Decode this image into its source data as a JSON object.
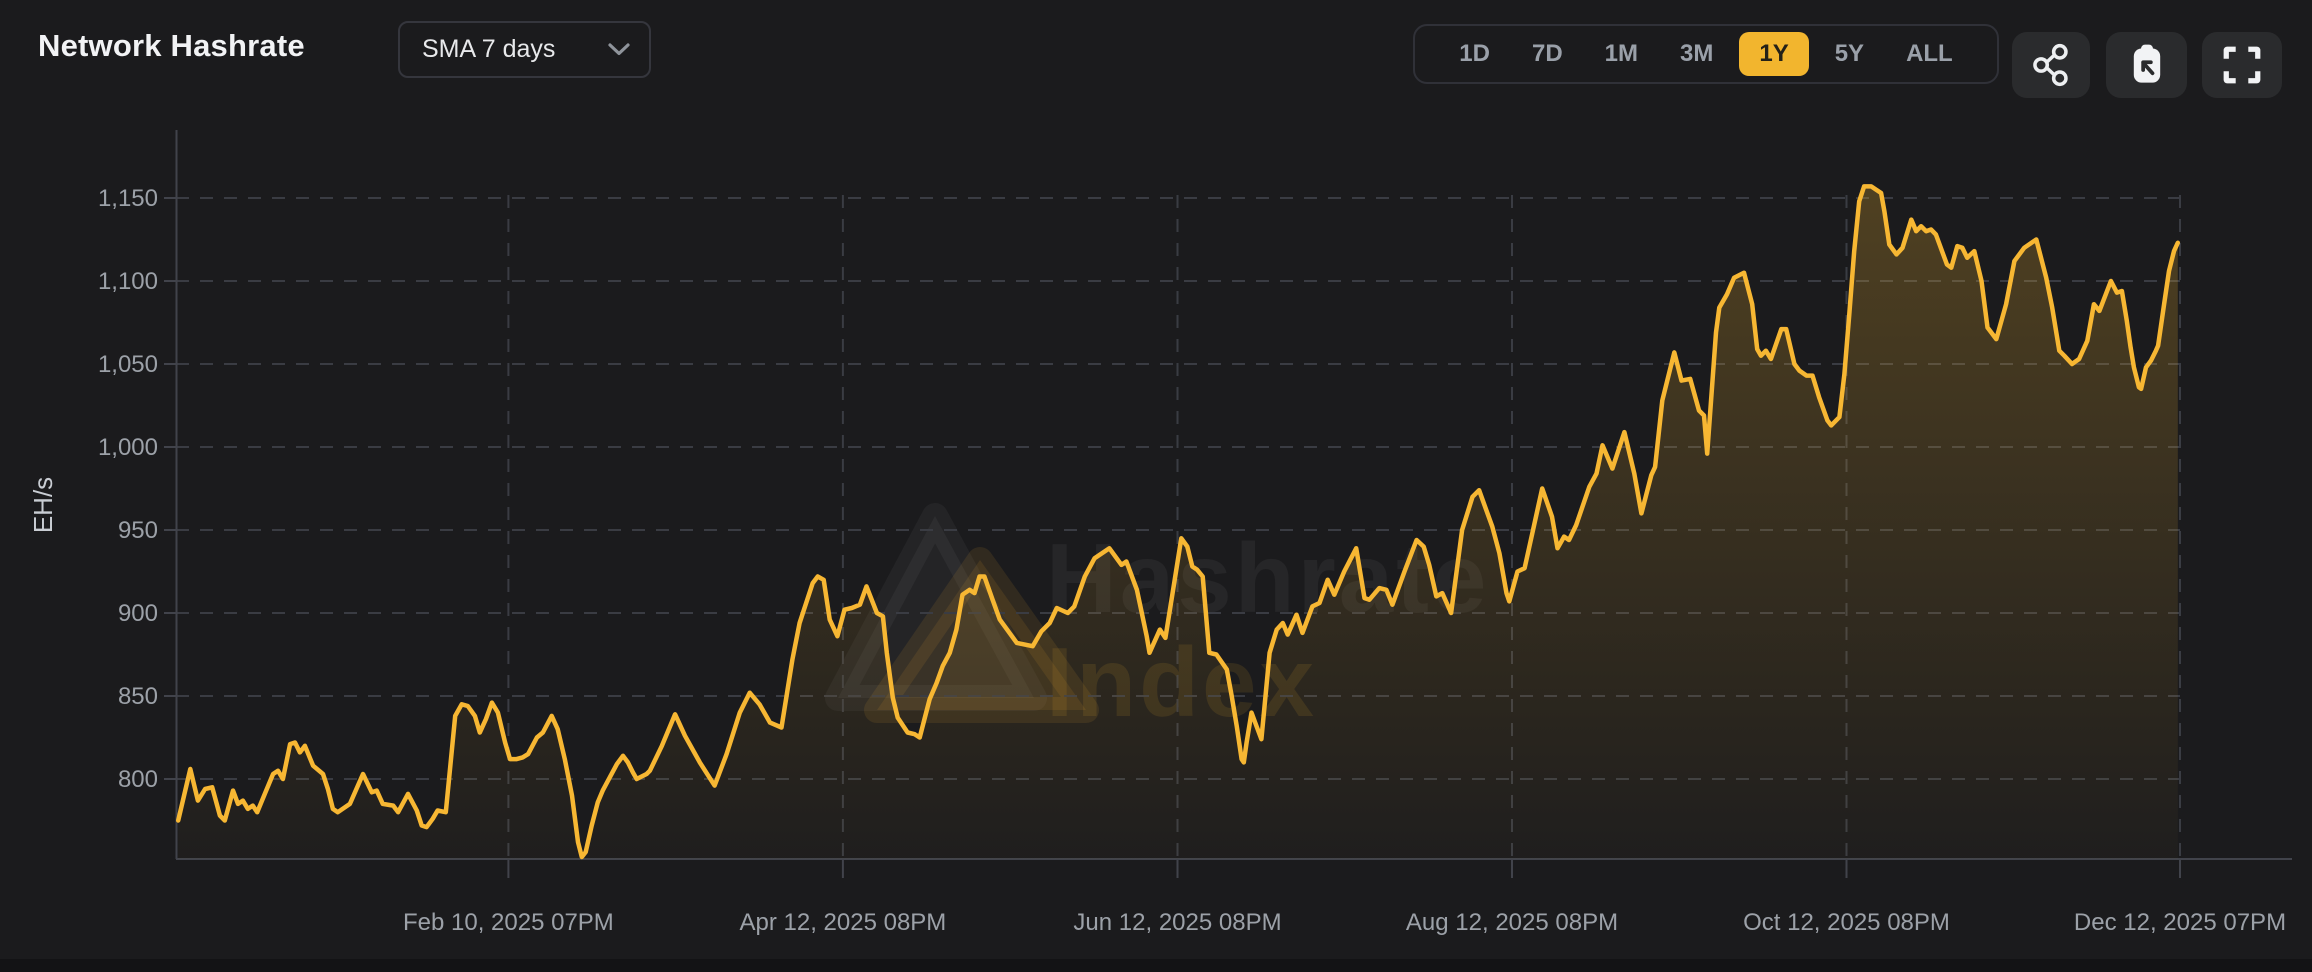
{
  "header": {
    "title": "Network Hashrate",
    "sma_dropdown": {
      "value": "SMA 7 days"
    },
    "range_buttons": [
      {
        "label": "1D",
        "active": false
      },
      {
        "label": "7D",
        "active": false
      },
      {
        "label": "1M",
        "active": false
      },
      {
        "label": "3M",
        "active": false
      },
      {
        "label": "1Y",
        "active": true
      },
      {
        "label": "5Y",
        "active": false
      },
      {
        "label": "ALL",
        "active": false
      }
    ],
    "icon_buttons": [
      "share-icon",
      "clipboard-export-icon",
      "fullscreen-icon"
    ]
  },
  "watermark": {
    "line1": "Hashrate",
    "line2": "Index"
  },
  "colors": {
    "background": "#1b1b1d",
    "accent_gold": "#f2b52e",
    "line_gold": "#f7b733",
    "grid": "#3a3c43",
    "axis": "#41434b",
    "tick_text": "#9ca1a8",
    "axis_label_text": "#c9cdd3",
    "button_bg": "#2a2b2d",
    "border": "#303138"
  },
  "chart_data": {
    "type": "line",
    "title": "Network Hashrate",
    "xlabel": "",
    "ylabel": "EH/s",
    "grid": "dashed",
    "legend_position": "none",
    "x_domain_days": [
      0,
      365.4
    ],
    "ylim": [
      752,
      1186
    ],
    "y_ticks": [
      {
        "v": 1150,
        "label": "1,150"
      },
      {
        "v": 1100,
        "label": "1,100"
      },
      {
        "v": 1050,
        "label": "1,050"
      },
      {
        "v": 1000,
        "label": "1,000"
      },
      {
        "v": 950,
        "label": "950"
      },
      {
        "v": 900,
        "label": "900"
      },
      {
        "v": 850,
        "label": "850"
      },
      {
        "v": 800,
        "label": "800"
      }
    ],
    "x_ticks": [
      {
        "day": 60.6,
        "label": "Feb 10, 2025 07PM"
      },
      {
        "day": 121.6,
        "label": "Apr 12, 2025 08PM"
      },
      {
        "day": 182.6,
        "label": "Jun 12, 2025 08PM"
      },
      {
        "day": 243.6,
        "label": "Aug 12, 2025 08PM"
      },
      {
        "day": 304.6,
        "label": "Oct 12, 2025 08PM"
      },
      {
        "day": 365.4,
        "label": "Dec 12, 2025 07PM"
      }
    ],
    "series": [
      {
        "name": "Network Hashrate (SMA 7 days), EH/s",
        "points": [
          [
            0.4,
            775
          ],
          [
            2.6,
            806
          ],
          [
            4,
            787
          ],
          [
            5.3,
            794
          ],
          [
            6.6,
            795
          ],
          [
            8,
            778
          ],
          [
            8.9,
            775
          ],
          [
            10.4,
            793
          ],
          [
            11.3,
            785
          ],
          [
            12.2,
            787
          ],
          [
            13.1,
            782
          ],
          [
            14,
            784
          ],
          [
            14.8,
            780
          ],
          [
            16.2,
            791
          ],
          [
            17.7,
            803
          ],
          [
            18.6,
            805
          ],
          [
            19.5,
            800
          ],
          [
            20.8,
            821
          ],
          [
            21.7,
            822
          ],
          [
            22.6,
            816
          ],
          [
            23.5,
            820
          ],
          [
            25,
            808
          ],
          [
            26.8,
            803
          ],
          [
            27.7,
            794
          ],
          [
            28.6,
            782
          ],
          [
            29.5,
            780
          ],
          [
            31.7,
            785
          ],
          [
            34.1,
            803
          ],
          [
            35.7,
            792
          ],
          [
            36.6,
            793
          ],
          [
            37.7,
            785
          ],
          [
            39.6,
            784
          ],
          [
            40.5,
            780
          ],
          [
            42.3,
            791
          ],
          [
            43.9,
            781
          ],
          [
            44.8,
            772
          ],
          [
            45.7,
            771
          ],
          [
            46.8,
            776
          ],
          [
            47.7,
            781
          ],
          [
            49.2,
            780
          ],
          [
            50.9,
            838
          ],
          [
            52.1,
            845
          ],
          [
            53.2,
            844
          ],
          [
            54.5,
            838
          ],
          [
            55.4,
            828
          ],
          [
            56.5,
            836
          ],
          [
            57.6,
            846
          ],
          [
            58.7,
            840
          ],
          [
            60,
            822
          ],
          [
            60.9,
            812
          ],
          [
            62.1,
            812
          ],
          [
            63.2,
            813
          ],
          [
            64.2,
            815
          ],
          [
            65.8,
            825
          ],
          [
            66.9,
            828
          ],
          [
            68.5,
            838
          ],
          [
            69.6,
            830
          ],
          [
            70.9,
            812
          ],
          [
            72.2,
            790
          ],
          [
            73.3,
            762
          ],
          [
            74,
            753
          ],
          [
            74.7,
            756
          ],
          [
            75.8,
            772
          ],
          [
            76.9,
            786
          ],
          [
            77.8,
            793
          ],
          [
            79.1,
            801
          ],
          [
            80.4,
            809
          ],
          [
            81.5,
            814
          ],
          [
            82.4,
            810
          ],
          [
            83.3,
            804
          ],
          [
            84,
            800
          ],
          [
            85.8,
            803
          ],
          [
            86.4,
            805
          ],
          [
            88.6,
            820
          ],
          [
            91,
            839
          ],
          [
            92.8,
            826
          ],
          [
            95.5,
            810
          ],
          [
            98.2,
            796
          ],
          [
            100.4,
            815
          ],
          [
            102.8,
            840
          ],
          [
            104.6,
            852
          ],
          [
            106.4,
            845
          ],
          [
            108.3,
            834
          ],
          [
            110.4,
            831
          ],
          [
            112.4,
            872
          ],
          [
            113.7,
            894
          ],
          [
            114.8,
            905
          ],
          [
            116.1,
            918
          ],
          [
            117,
            922
          ],
          [
            118.1,
            920
          ],
          [
            119.2,
            896
          ],
          [
            120.6,
            886
          ],
          [
            121.9,
            902
          ],
          [
            123.2,
            903
          ],
          [
            124.7,
            905
          ],
          [
            125.9,
            916
          ],
          [
            127.8,
            900
          ],
          [
            128.9,
            898
          ],
          [
            129.6,
            876
          ],
          [
            130.7,
            849
          ],
          [
            131.6,
            837
          ],
          [
            133.4,
            828
          ],
          [
            134.7,
            827
          ],
          [
            135.6,
            825
          ],
          [
            137.4,
            848
          ],
          [
            138.7,
            858
          ],
          [
            139.8,
            868
          ],
          [
            141.1,
            876
          ],
          [
            142.3,
            890
          ],
          [
            143.4,
            911
          ],
          [
            144.7,
            914
          ],
          [
            145.6,
            912
          ],
          [
            146.5,
            922
          ],
          [
            147.4,
            922
          ],
          [
            148.9,
            908
          ],
          [
            150.2,
            896
          ],
          [
            153.3,
            882
          ],
          [
            156.2,
            880
          ],
          [
            157.8,
            889
          ],
          [
            159.3,
            894
          ],
          [
            160.6,
            903
          ],
          [
            162.6,
            900
          ],
          [
            163.8,
            904
          ],
          [
            165.7,
            922
          ],
          [
            167.5,
            933
          ],
          [
            170.2,
            939
          ],
          [
            172.4,
            929
          ],
          [
            173.3,
            931
          ],
          [
            175.2,
            914
          ],
          [
            177,
            886
          ],
          [
            177.5,
            876
          ],
          [
            179.4,
            890
          ],
          [
            180.4,
            885
          ],
          [
            182.1,
            920
          ],
          [
            183.3,
            945
          ],
          [
            184.4,
            940
          ],
          [
            185.3,
            928
          ],
          [
            186.2,
            926
          ],
          [
            187.2,
            922
          ],
          [
            188.4,
            876
          ],
          [
            189.7,
            875
          ],
          [
            191.6,
            866
          ],
          [
            192.5,
            850
          ],
          [
            193.4,
            832
          ],
          [
            194.3,
            812
          ],
          [
            194.7,
            810
          ],
          [
            195.2,
            822
          ],
          [
            196.1,
            840
          ],
          [
            197,
            832
          ],
          [
            197.9,
            824
          ],
          [
            199.4,
            876
          ],
          [
            200.7,
            890
          ],
          [
            201.8,
            894
          ],
          [
            202.7,
            887
          ],
          [
            204.3,
            899
          ],
          [
            205.4,
            888
          ],
          [
            207.2,
            904
          ],
          [
            208.5,
            906
          ],
          [
            210,
            920
          ],
          [
            211.2,
            911
          ],
          [
            213,
            925
          ],
          [
            215.2,
            939
          ],
          [
            216.7,
            909
          ],
          [
            217.6,
            908
          ],
          [
            219.4,
            915
          ],
          [
            220.7,
            914
          ],
          [
            221.8,
            905
          ],
          [
            224,
            925
          ],
          [
            226.2,
            944
          ],
          [
            227.5,
            940
          ],
          [
            228.5,
            929
          ],
          [
            229.8,
            910
          ],
          [
            230.9,
            912
          ],
          [
            232.5,
            900
          ],
          [
            234.5,
            950
          ],
          [
            236.4,
            970
          ],
          [
            237.6,
            974
          ],
          [
            240,
            952
          ],
          [
            241.3,
            936
          ],
          [
            242.6,
            912
          ],
          [
            243.1,
            907
          ],
          [
            244.6,
            925
          ],
          [
            245.9,
            927
          ],
          [
            247.3,
            948
          ],
          [
            249.1,
            975
          ],
          [
            250.9,
            958
          ],
          [
            251.9,
            939
          ],
          [
            253.1,
            946
          ],
          [
            254,
            944
          ],
          [
            255.3,
            953
          ],
          [
            257.7,
            976
          ],
          [
            259,
            984
          ],
          [
            260.1,
            1001
          ],
          [
            261.9,
            987
          ],
          [
            264.1,
            1009
          ],
          [
            265.9,
            984
          ],
          [
            267.2,
            960
          ],
          [
            269,
            983
          ],
          [
            269.7,
            988
          ],
          [
            271,
            1028
          ],
          [
            273.2,
            1057
          ],
          [
            274.5,
            1040
          ],
          [
            276.1,
            1041
          ],
          [
            277.7,
            1022
          ],
          [
            278.6,
            1019
          ],
          [
            279.2,
            996
          ],
          [
            280.8,
            1069
          ],
          [
            281.4,
            1084
          ],
          [
            282.8,
            1092
          ],
          [
            284.1,
            1102
          ],
          [
            285.9,
            1105
          ],
          [
            287.4,
            1086
          ],
          [
            288.3,
            1059
          ],
          [
            289,
            1055
          ],
          [
            289.9,
            1058
          ],
          [
            290.8,
            1053
          ],
          [
            292.7,
            1071
          ],
          [
            293.6,
            1071
          ],
          [
            295.1,
            1050
          ],
          [
            296,
            1046
          ],
          [
            297.3,
            1043
          ],
          [
            298.4,
            1043
          ],
          [
            299.6,
            1030
          ],
          [
            301.1,
            1016
          ],
          [
            301.8,
            1013
          ],
          [
            303.3,
            1018
          ],
          [
            304.2,
            1044
          ],
          [
            305.1,
            1080
          ],
          [
            306,
            1118
          ],
          [
            306.9,
            1148
          ],
          [
            307.8,
            1157
          ],
          [
            309.1,
            1157
          ],
          [
            310,
            1155
          ],
          [
            310.9,
            1153
          ],
          [
            311.5,
            1142
          ],
          [
            312.4,
            1122
          ],
          [
            313.7,
            1116
          ],
          [
            314.8,
            1120
          ],
          [
            316.4,
            1137
          ],
          [
            317.3,
            1130
          ],
          [
            318.2,
            1133
          ],
          [
            319.1,
            1130
          ],
          [
            320,
            1131
          ],
          [
            320.9,
            1128
          ],
          [
            322.9,
            1110
          ],
          [
            323.7,
            1108
          ],
          [
            324.8,
            1121
          ],
          [
            325.7,
            1120
          ],
          [
            326.6,
            1114
          ],
          [
            327.9,
            1118
          ],
          [
            329.2,
            1100
          ],
          [
            330.3,
            1072
          ],
          [
            331.9,
            1065
          ],
          [
            333.7,
            1086
          ],
          [
            335.2,
            1112
          ],
          [
            337,
            1120
          ],
          [
            339.2,
            1125
          ],
          [
            341,
            1102
          ],
          [
            342.1,
            1084
          ],
          [
            343.4,
            1058
          ],
          [
            344.3,
            1055
          ],
          [
            345.7,
            1050
          ],
          [
            347,
            1053
          ],
          [
            348.5,
            1064
          ],
          [
            349.7,
            1086
          ],
          [
            350.7,
            1082
          ],
          [
            352.8,
            1100
          ],
          [
            353.9,
            1093
          ],
          [
            354.8,
            1094
          ],
          [
            355.7,
            1076
          ],
          [
            356.4,
            1060
          ],
          [
            357,
            1048
          ],
          [
            357.9,
            1036
          ],
          [
            358.3,
            1035
          ],
          [
            359.2,
            1048
          ],
          [
            360.1,
            1052
          ],
          [
            361,
            1058
          ],
          [
            361.4,
            1061
          ],
          [
            362.5,
            1086
          ],
          [
            363.4,
            1106
          ],
          [
            364.3,
            1118
          ],
          [
            365,
            1123
          ]
        ]
      }
    ]
  }
}
